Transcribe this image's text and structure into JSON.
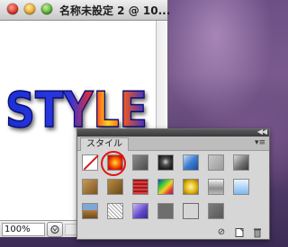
{
  "document": {
    "title": "名称未設定 2 @ 10...",
    "canvas_text": "STYLE",
    "zoom": "100%"
  },
  "styles_panel": {
    "tab_label": "スタイル",
    "collapse_label": "◀◀",
    "menu_label": "▾≡",
    "swatches": [
      "default-style-none",
      "glow-style",
      "gray-bevel-style",
      "dark-button-style",
      "blue-fold-style",
      "light-gray-style",
      "gray-shade-style",
      "wood-style",
      "brown-style",
      "red-stripe-style",
      "multicolor-style",
      "gold-style",
      "steel-style",
      "sky-blue-style",
      "landscape-style",
      "pattern-style",
      "purple-bevel-style",
      "flat-gray-style",
      "outline-style",
      "mid-gray-style"
    ],
    "selected_swatch": "glow-style",
    "bottom_icons": [
      "clear-style-icon",
      "new-style-icon",
      "delete-style-icon"
    ]
  },
  "colors": {
    "highlight_circle": "#e01414",
    "text_blue": "#1c2fd6",
    "text_glow": "#ff7a00"
  }
}
